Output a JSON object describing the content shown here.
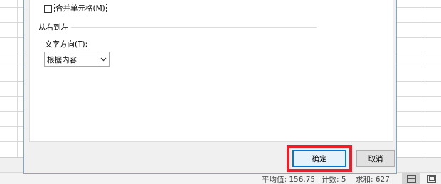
{
  "dialog": {
    "merge_cells_label": "合并单元格(M)",
    "rtl_group_title": "从右到左",
    "text_direction_label": "文字方向(T):",
    "text_direction_value": "根据内容",
    "ok_label": "确定",
    "cancel_label": "取消"
  },
  "statusbar": {
    "average": "平均值: 156.75",
    "count": "计数: 5",
    "sum": "求和: 627"
  },
  "colors": {
    "highlight": "#e8202a",
    "accent": "#0078d7"
  }
}
